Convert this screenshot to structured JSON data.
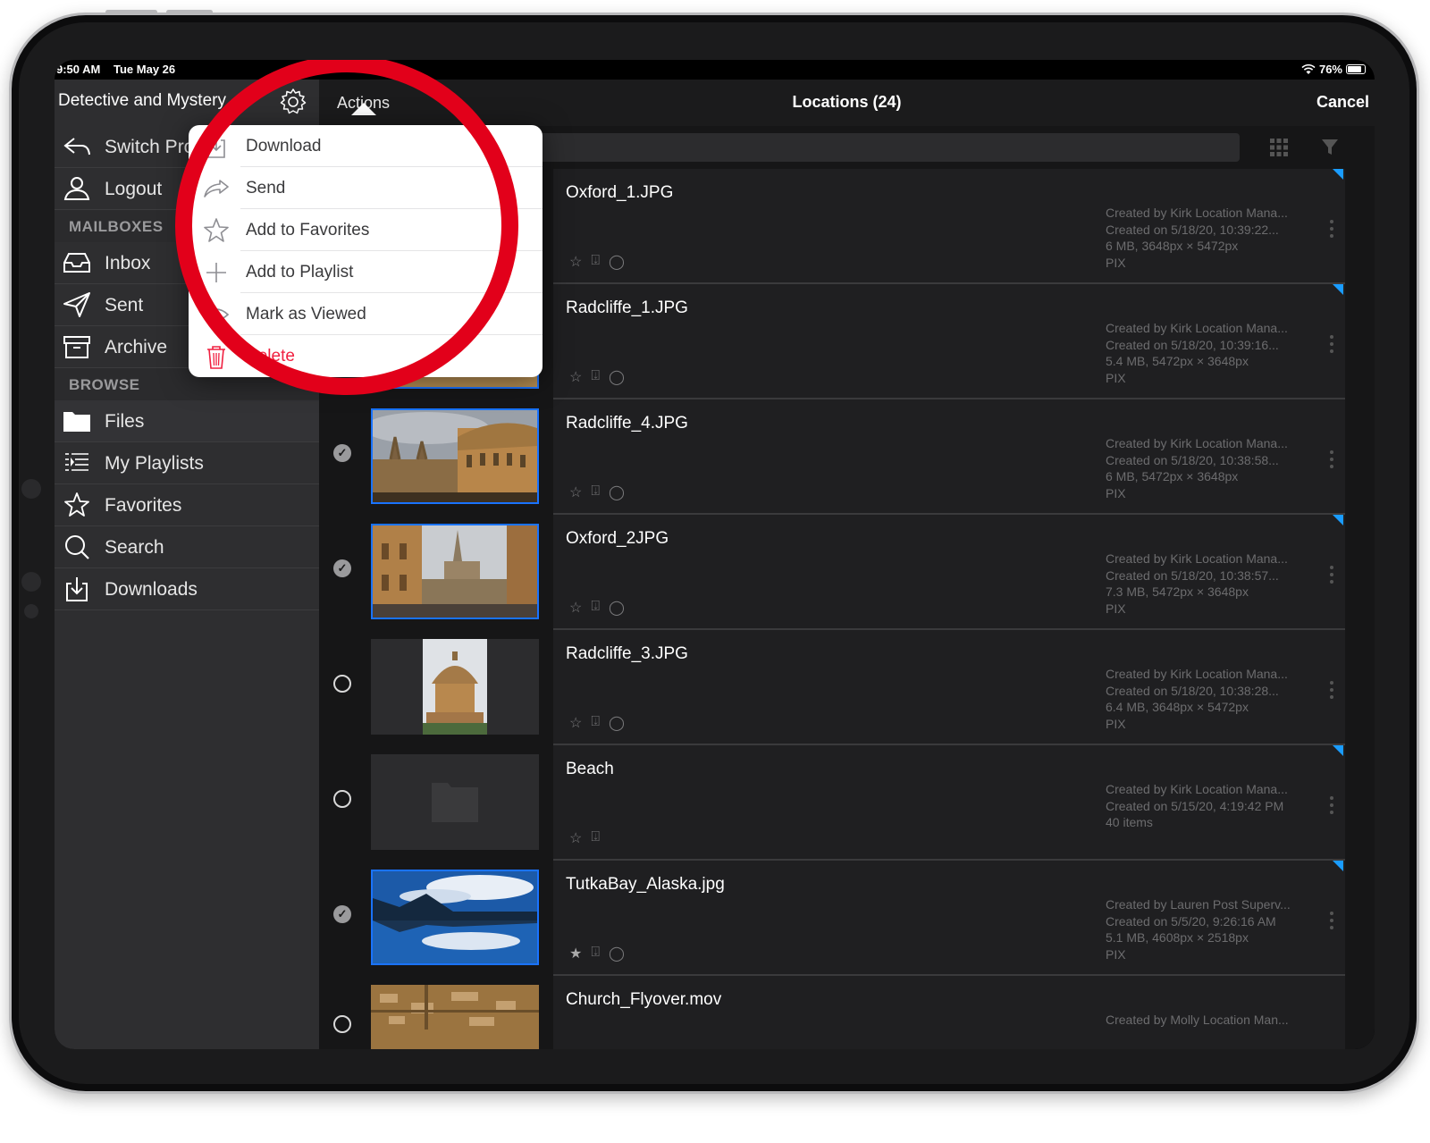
{
  "status": {
    "time": "9:50 AM",
    "date": "Tue May 26",
    "battery": "76%"
  },
  "sidebar": {
    "title": "Detective and Mystery",
    "top_items": [
      {
        "label": "Switch Projects",
        "icon": "switch-icon"
      },
      {
        "label": "Logout",
        "icon": "user-icon"
      }
    ],
    "mailboxes_header": "MAILBOXES",
    "mailboxes": [
      {
        "label": "Inbox",
        "icon": "inbox-icon"
      },
      {
        "label": "Sent",
        "icon": "paper-plane-icon"
      },
      {
        "label": "Archive",
        "icon": "archive-box-icon"
      }
    ],
    "browse_header": "BROWSE",
    "browse": [
      {
        "label": "Files",
        "icon": "folder-icon"
      },
      {
        "label": "My Playlists",
        "icon": "playlist-icon"
      },
      {
        "label": "Favorites",
        "icon": "star-icon"
      },
      {
        "label": "Search",
        "icon": "search-icon"
      },
      {
        "label": "Downloads",
        "icon": "download-icon"
      }
    ]
  },
  "topbar": {
    "actions": "Actions",
    "title": "Locations (24)",
    "cancel": "Cancel"
  },
  "popover": {
    "items": [
      {
        "label": "Download",
        "icon": "download-icon"
      },
      {
        "label": "Send",
        "icon": "share-arrow-icon"
      },
      {
        "label": "Add to Favorites",
        "icon": "star-icon"
      },
      {
        "label": "Add to Playlist",
        "icon": "plus-icon"
      },
      {
        "label": "Mark as Viewed",
        "icon": "eye-icon"
      },
      {
        "label": "Delete",
        "icon": "trash-icon"
      }
    ]
  },
  "files": [
    {
      "name": "Oxford_1.JPG",
      "meta": [
        "Created by Kirk Location Mana...",
        "Created on 5/18/20, 10:39:22...",
        "6 MB, 3648px × 5472px",
        "PIX"
      ],
      "selected": true,
      "comment": true
    },
    {
      "name": "Radcliffe_1.JPG",
      "meta": [
        "Created by Kirk Location Mana...",
        "Created on 5/18/20, 10:39:16...",
        "5.4 MB, 5472px × 3648px",
        "PIX"
      ],
      "selected": true,
      "comment": true
    },
    {
      "name": "Radcliffe_4.JPG",
      "meta": [
        "Created by Kirk Location Mana...",
        "Created on 5/18/20, 10:38:58...",
        "6 MB, 5472px × 3648px",
        "PIX"
      ],
      "selected": true,
      "comment": true
    },
    {
      "name": "Oxford_2JPG",
      "meta": [
        "Created by Kirk Location Mana...",
        "Created on 5/18/20, 10:38:57...",
        "7.3 MB, 5472px × 3648px",
        "PIX"
      ],
      "selected": true,
      "comment": true
    },
    {
      "name": "Radcliffe_3.JPG",
      "meta": [
        "Created by Kirk Location Mana...",
        "Created on 5/18/20, 10:38:28...",
        "6.4 MB, 3648px × 5472px",
        "PIX"
      ],
      "selected": false,
      "comment": true
    },
    {
      "name": "Beach",
      "meta": [
        "Created by Kirk Location Mana...",
        "Created on 5/15/20, 4:19:42 PM",
        "40 items"
      ],
      "selected": false,
      "comment": false
    },
    {
      "name": "TutkaBay_Alaska.jpg",
      "meta": [
        "Created by Lauren Post Superv...",
        "Created on 5/5/20, 9:26:16 AM",
        "5.1 MB, 4608px × 2518px",
        "PIX"
      ],
      "selected": true,
      "comment": true
    },
    {
      "name": "Church_Flyover.mov",
      "meta": [
        "Created by Molly Location Man..."
      ],
      "selected": false,
      "comment": false
    }
  ],
  "colors": {
    "accent": "#1a73ff",
    "highlight_ring": "#e2001a",
    "delete": "#f02040"
  }
}
